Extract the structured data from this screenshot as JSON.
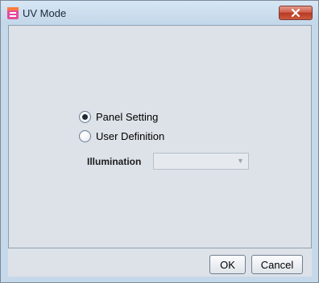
{
  "window": {
    "title": "UV Mode"
  },
  "options": {
    "panel_setting_label": "Panel Setting",
    "user_definition_label": "User Definition",
    "selected": "Panel Setting"
  },
  "illumination": {
    "label": "Illumination",
    "value": ""
  },
  "buttons": {
    "ok_label": "OK",
    "cancel_label": "Cancel"
  },
  "colors": {
    "client_background": "#dde2e8",
    "frame_background": "#c5d9ea",
    "close_button": "#c9503d"
  },
  "icons": {
    "app": "uv-mode-app-icon",
    "close": "close-icon",
    "dropdown": "chevron-down-icon"
  }
}
